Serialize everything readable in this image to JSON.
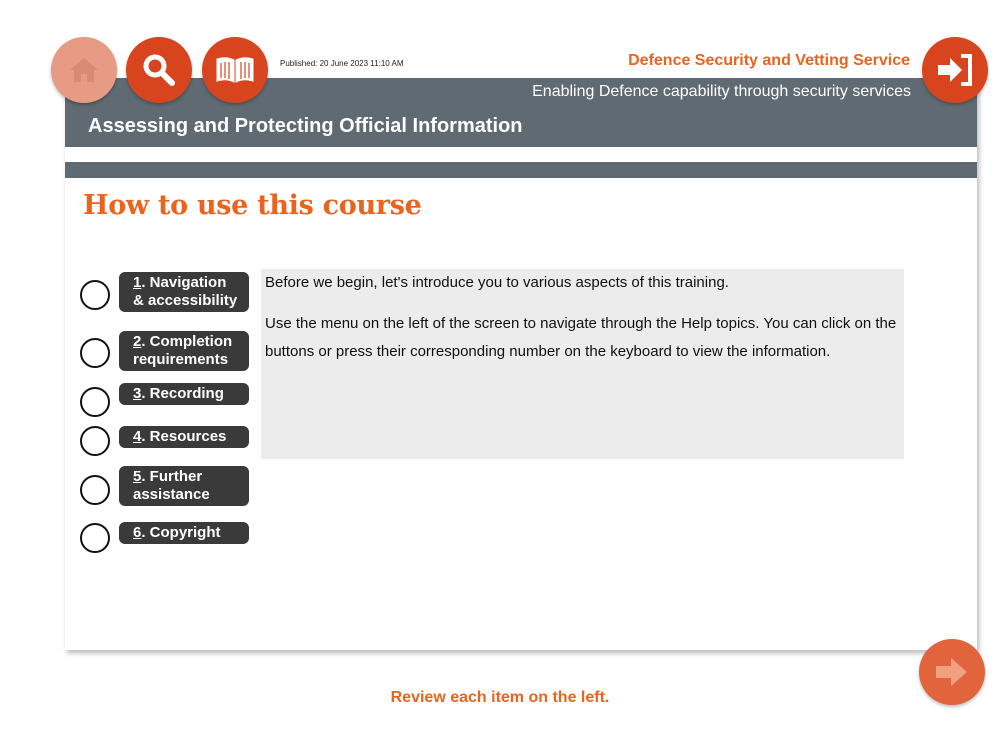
{
  "topbar": {
    "published": "Published: 20 June 2023 11:10 AM",
    "org_name": "Defence Security and Vetting Service",
    "tagline": "Enabling Defence capability through security services",
    "course_title": "Assessing and Protecting Official Information"
  },
  "buttons": {
    "home_icon": "home-icon",
    "search_icon": "search-icon",
    "glossary_icon": "book-icon",
    "exit_icon": "exit-icon",
    "next_icon": "next-arrow-icon"
  },
  "colors": {
    "accent": "#e8641f",
    "button_red": "#d8441d",
    "header_gray": "#5f6a72",
    "pill_dark": "#3a3a3a"
  },
  "page": {
    "title": "How to use this course",
    "menu": [
      {
        "num": "1",
        "line1": ". Navigation",
        "line2": "& accessibility"
      },
      {
        "num": "2",
        "line1": ". Completion",
        "line2": "requirements"
      },
      {
        "num": "3",
        "line1": ". Recording",
        "line2": ""
      },
      {
        "num": "4",
        "line1": ". Resources",
        "line2": ""
      },
      {
        "num": "5",
        "line1": ". Further",
        "line2": "assistance"
      },
      {
        "num": "6",
        "line1": ". Copyright",
        "line2": ""
      }
    ],
    "content": {
      "para1": "Before we begin, let's introduce you to various aspects of this training.",
      "para2": "Use the menu on the left of the screen to navigate through the Help topics. You can click on the buttons or press their corresponding number on the keyboard to view the information."
    },
    "instruction": "Review each item on the left."
  }
}
